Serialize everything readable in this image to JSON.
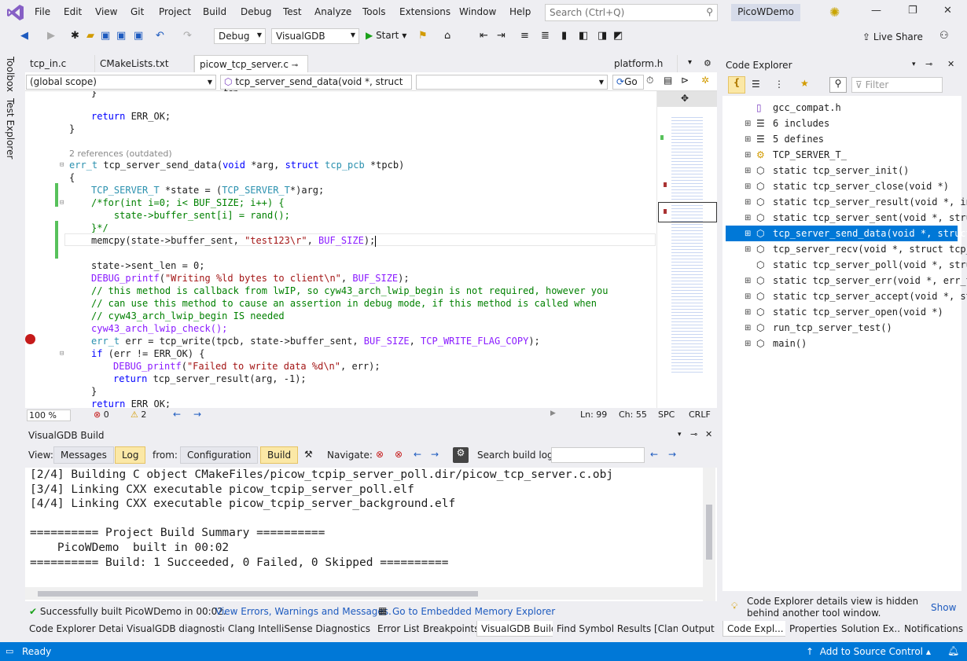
{
  "menu": {
    "items": [
      "File",
      "Edit",
      "View",
      "Git",
      "Project",
      "Build",
      "Debug",
      "Test",
      "Analyze",
      "Tools",
      "Extensions",
      "Window",
      "Help"
    ],
    "search_placeholder": "Search (Ctrl+Q)",
    "solution": "PicoWDemo"
  },
  "toolbar": {
    "config": "Debug",
    "platform": "VisualGDB",
    "start": "Start",
    "live_share": "Live Share"
  },
  "sidetabs": [
    "Toolbox",
    "Test Explorer"
  ],
  "editor_tabs": [
    "tcp_in.c",
    "CMakeLists.txt",
    "picow_tcp_server.c",
    "platform.h"
  ],
  "nav": {
    "scope": "(global scope)",
    "func": "tcp_server_send_data(void *, struct tcp",
    "go": "Go"
  },
  "code": {
    "l1": "}",
    "l2a": "return",
    "l2b": " ERR_OK;",
    "l3": "}",
    "refs": "2 references (outdated)",
    "sig1": "err_t",
    "sig2": " tcp_server_send_data(",
    "sig3": "void",
    "sig4": " *arg, ",
    "sig5": "struct",
    "sig6": " tcp_pcb",
    "sig7": " *tpcb)",
    "brace": "{",
    "s1a": "TCP_SERVER_T",
    "s1b": " *state = (",
    "s1c": "TCP_SERVER_T",
    "s1d": "*)arg;",
    "c1": "/*for(int i=0; i< BUF_SIZE; i++) {",
    "c2": "    state->buffer_sent[i] = rand();",
    "c3": "}*/",
    "m1": "memcpy(state->buffer_sent, ",
    "m2": "\"test123\\r\"",
    "m3": ", ",
    "m4": "BUF_SIZE",
    "m5": ");",
    "sl": "state->sent_len = 0;",
    "dp1": "DEBUG_printf",
    "dp2": "(",
    "dp3": "\"Writing %ld bytes to client\\n\"",
    "dp4": ", ",
    "dp5": "BUF_SIZE",
    "dp6": ");",
    "cm1": "// this method is callback from lwIP, so cyw43_arch_lwip_begin is not required, however you",
    "cm2": "// can use this method to cause an assertion in debug mode, if this method is called when",
    "cm3": "// cyw43_arch_lwip_begin IS needed",
    "chk": "cyw43_arch_lwip_check();",
    "e1": "err_t",
    "e2": " err = tcp_write(tpcb, state->buffer_sent, ",
    "e3": "BUF_SIZE",
    "e4": ", ",
    "e5": "TCP_WRITE_FLAG_COPY",
    "e6": ");",
    "if1": "if",
    "if2": " (err != ERR_OK) {",
    "d1": "DEBUG_printf",
    "d2": "(",
    "d3": "\"Failed to write data %d\\n\"",
    "d4": ", err);",
    "r1": "return",
    "r2": " tcp_server_result(arg, -1);",
    "cb": "}",
    "rr1": "return",
    "rr2": " ERR_OK;"
  },
  "edstatus": {
    "zoom": "100 %",
    "errors": "0",
    "warnings": "2",
    "ln": "Ln: 99",
    "ch": "Ch: 55",
    "spc": "SPC",
    "crlf": "CRLF"
  },
  "build": {
    "title": "VisualGDB Build",
    "view": "View:",
    "messages": "Messages",
    "log": "Log",
    "from": "from:",
    "configuration": "Configuration",
    "build": "Build",
    "navigate": "Navigate:",
    "search": "Search build log:",
    "log_lines": [
      "[2/4] Building C object CMakeFiles/picow_tcpip_server_poll.dir/picow_tcp_server.c.obj",
      "[3/4] Linking CXX executable picow_tcpip_server_poll.elf",
      "[4/4] Linking CXX executable picow_tcpip_server_background.elf",
      "",
      "========== Project Build Summary ==========",
      "    PicoWDemo  built in 00:02",
      "========== Build: 1 Succeeded, 0 Failed, 0 Skipped =========="
    ],
    "status": "Successfully built PicoWDemo in 00:02.",
    "link1": "View Errors, Warnings and Messages.",
    "link2": "Go to Embedded Memory Explorer"
  },
  "bottom_tabs": [
    "Code Explorer Details",
    "VisualGDB diagnostics",
    "Clang IntelliSense Diagnostics C...",
    "Error List",
    "Breakpoints",
    "VisualGDB Build",
    "Find Symbol Results [Clang]",
    "Output"
  ],
  "code_explorer": {
    "title": "Code Explorer",
    "filter": "Filter",
    "items": [
      "gcc_compat.h",
      "6 includes",
      "5 defines",
      "TCP_SERVER_T_",
      "static tcp_server_init()",
      "static tcp_server_close(void *)",
      "static tcp_server_result(void *, in",
      "static tcp_server_sent(void *, stru",
      "tcp_server_send_data(void *, struct",
      "tcp_server_recv(void *, struct tcp_",
      "static tcp_server_poll(void *, stru",
      "static tcp_server_err(void *, err_t",
      "static tcp_server_accept(void *, st",
      "static tcp_server_open(void *)",
      "run_tcp_server_test()",
      "main()"
    ],
    "note": "Code Explorer details view is hidden behind another tool window.",
    "show": "Show",
    "tabs": [
      "Code Expl...",
      "Properties",
      "Solution Ex...",
      "Notifications"
    ]
  },
  "status": {
    "ready": "Ready",
    "source_control": "Add to Source Control"
  }
}
